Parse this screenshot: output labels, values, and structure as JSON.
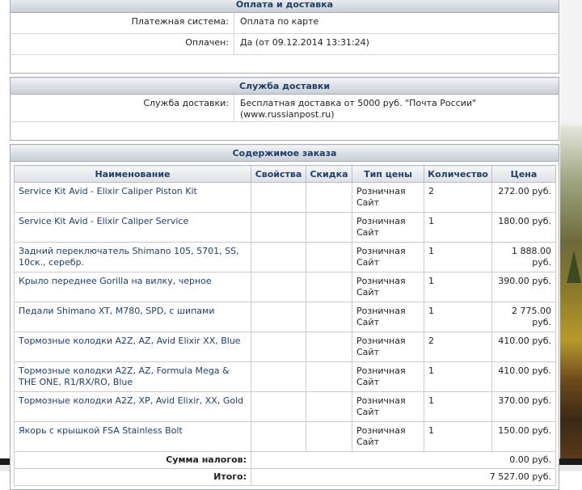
{
  "payment_section": {
    "title": "Оплата и доставка",
    "rows": [
      {
        "label": "Платежная система:",
        "value": "Оплата по карте"
      },
      {
        "label": "Оплачен:",
        "value": "Да (от 09.12.2014 13:31:24)"
      }
    ]
  },
  "delivery_section": {
    "title": "Служба доставки",
    "label": "Служба доставки:",
    "value": "Бесплатная доставка от 5000 руб. \"Почта России\" (www.russianpost.ru)"
  },
  "order_section": {
    "title": "Содержимое заказа",
    "columns": [
      "Наименование",
      "Свойства",
      "Скидка",
      "Тип цены",
      "Количество",
      "Цена"
    ],
    "items": [
      {
        "name": "Service Kit Avid - Elixir Caliper Piston Kit",
        "props": "",
        "discount": "",
        "price_type": "Розничная Сайт",
        "qty": "2",
        "price": "272.00 руб."
      },
      {
        "name": "Service Kit Avid - Elixir Caliper Service",
        "props": "",
        "discount": "",
        "price_type": "Розничная Сайт",
        "qty": "1",
        "price": "180.00 руб."
      },
      {
        "name": "Задний переключатель Shimano 105, 5701, SS, 10ск., серебр.",
        "props": "",
        "discount": "",
        "price_type": "Розничная Сайт",
        "qty": "1",
        "price": "1 888.00 руб."
      },
      {
        "name": "Крыло переднее Gorilla на вилку, черное",
        "props": "",
        "discount": "",
        "price_type": "Розничная Сайт",
        "qty": "1",
        "price": "390.00 руб."
      },
      {
        "name": "Педали Shimano XT, M780, SPD, с шипами",
        "props": "",
        "discount": "",
        "price_type": "Розничная Сайт",
        "qty": "1",
        "price": "2 775.00 руб."
      },
      {
        "name": "Тормозные колодки A2Z, AZ, Avid Elixir XX, Blue",
        "props": "",
        "discount": "",
        "price_type": "Розничная Сайт",
        "qty": "2",
        "price": "410.00 руб."
      },
      {
        "name": "Тормозные колодки A2Z, AZ, Formula Mega & THE ONE, R1/RX/RO, Blue",
        "props": "",
        "discount": "",
        "price_type": "Розничная Сайт",
        "qty": "1",
        "price": "410.00 руб."
      },
      {
        "name": "Тормозные колодки A2Z, XP, Avid Elixir, XX, Gold",
        "props": "",
        "discount": "",
        "price_type": "Розничная Сайт",
        "qty": "1",
        "price": "370.00 руб."
      },
      {
        "name": "Якорь с крышкой FSA Stainless Bolt",
        "props": "",
        "discount": "",
        "price_type": "Розничная Сайт",
        "qty": "1",
        "price": "150.00 руб."
      }
    ],
    "tax_label": "Сумма налогов:",
    "tax_value": "0.00 руб.",
    "total_label": "Итого:",
    "total_value": "7 527.00 руб."
  }
}
